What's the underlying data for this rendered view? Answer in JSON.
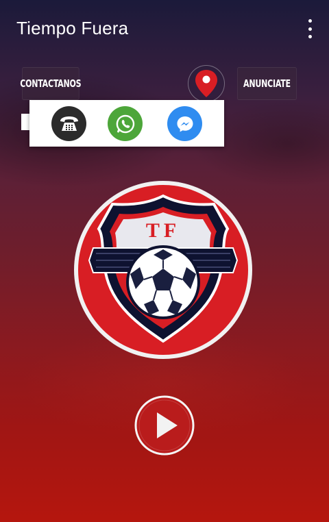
{
  "app": {
    "title": "Tiempo Fuera"
  },
  "icons": {
    "menu": "more-vert-icon",
    "location": "map-pin-icon",
    "phone": "phone-icon",
    "whatsapp": "whatsapp-icon",
    "messenger": "messenger-icon",
    "play": "play-icon"
  },
  "buttons": {
    "contact_label": "CONTACTANOS",
    "ads_label": "ANUNCIATE"
  },
  "logo": {
    "text": "TF"
  },
  "colors": {
    "brand_red": "#d81e24",
    "whatsapp": "#4da63a",
    "messenger": "#2f8cf0",
    "phone": "#2b2b2b"
  }
}
